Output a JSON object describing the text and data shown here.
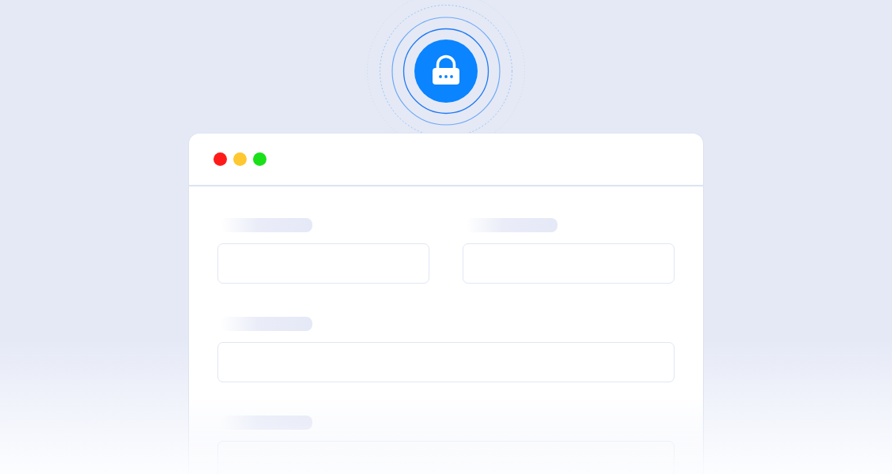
{
  "window": {
    "controls": [
      {
        "color": "#ff1a1a"
      },
      {
        "color": "#ffc730"
      },
      {
        "color": "#1ae01a"
      }
    ]
  },
  "form": {
    "fields": [
      {
        "kind": "half"
      },
      {
        "kind": "half"
      },
      {
        "kind": "full"
      },
      {
        "kind": "full"
      }
    ]
  }
}
